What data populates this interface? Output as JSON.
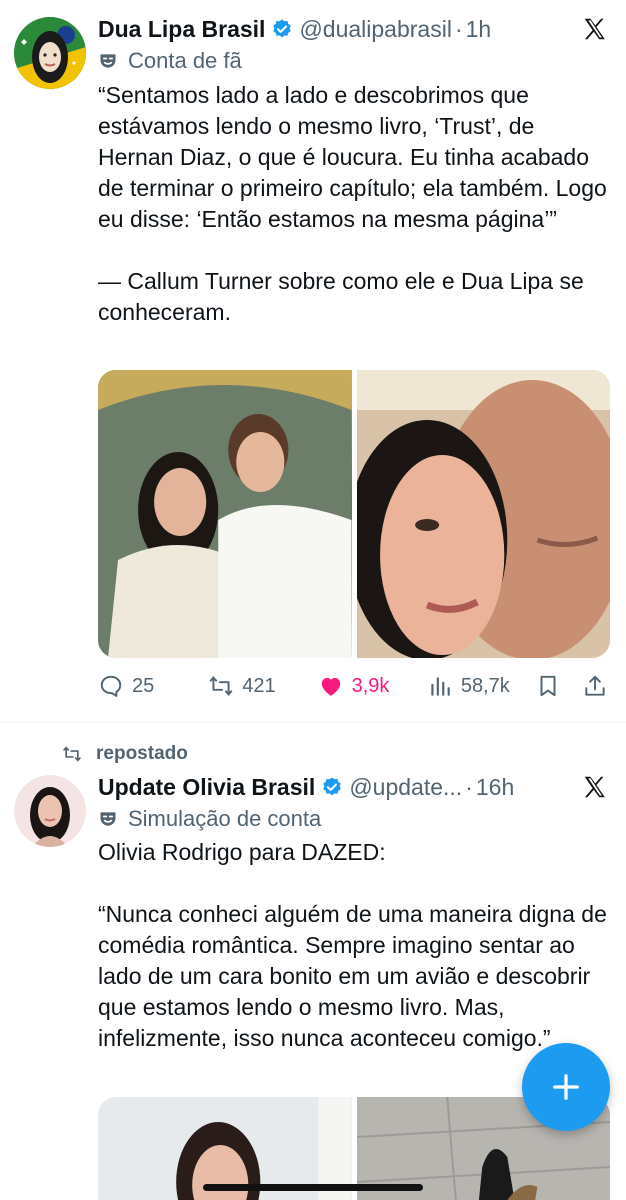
{
  "tweets": [
    {
      "display_name": "Dua Lipa Brasil",
      "handle": "@dualipabrasil",
      "time": "1h",
      "account_label": "Conta de fã",
      "text": "“Sentamos lado a lado e descobrimos que estávamos lendo o mesmo livro, ‘Trust’, de Hernan Diaz, o que é loucura. Eu tinha acabado de terminar o primeiro capítulo; ela também. Logo eu disse: ‘Então estamos na mesma página’”\n\n— Callum Turner sobre como ele e Dua Lipa se conheceram.",
      "stats": {
        "replies": "25",
        "reposts": "421",
        "likes": "3,9k",
        "views": "58,7k"
      },
      "liked": true
    },
    {
      "repost_label": "repostado",
      "display_name": "Update Olivia Brasil",
      "handle": "@update...",
      "time": "16h",
      "account_label": "Simulação de conta",
      "text": "Olivia Rodrigo para DAZED:\n\n“Nunca conheci alguém de uma maneira digna de comédia romântica. Sempre imagino sentar ao lado de um cara bonito em um avião e descobrir que estamos lendo o mesmo livro. Mas, infelizmente, isso nunca aconteceu comigo.”"
    }
  ],
  "colors": {
    "accent": "#1d9bf0",
    "like": "#f91880",
    "secondary_text": "#536471"
  },
  "icons": [
    "verified-badge-icon",
    "x-logo-icon",
    "mask-icon",
    "reply-icon",
    "repost-icon",
    "heart-icon",
    "views-icon",
    "bookmark-icon",
    "share-icon",
    "plus-icon"
  ]
}
